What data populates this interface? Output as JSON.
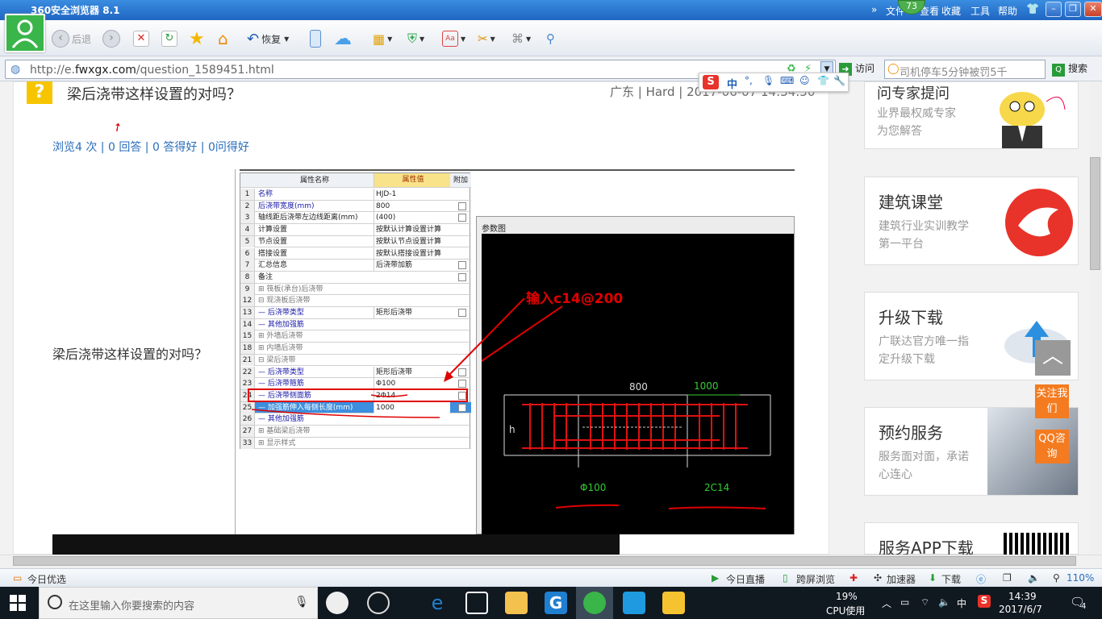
{
  "browser": {
    "title": "360安全浏览器 8.1",
    "menu": [
      "文件",
      "查看",
      "收藏",
      "工具",
      "帮助"
    ],
    "badge": "73",
    "toolbar": {
      "back": "后退",
      "restore": "恢复"
    },
    "address": {
      "prefix": "http://e.",
      "domain": "fwxgx.com",
      "path": "/question_1589451.html"
    },
    "visit_label": "访问",
    "search_value": "司机停车5分钟被罚5千",
    "search_button": "搜索"
  },
  "ime": {
    "lang": "中"
  },
  "question": {
    "title": "梁后浇带这样设置的对吗？",
    "meta": "广东 | Hard | 2017-06-07 14:34:50",
    "stats": {
      "views": "浏览4 次",
      "answers": "0 回答",
      "good": "0 答得好",
      "ask_good": "0问得好"
    },
    "body": "梁后浇带这样设置的对吗？"
  },
  "prop_grid": {
    "headers": [
      "属性名称",
      "属性值",
      "附加"
    ],
    "rows": [
      {
        "n": "1",
        "k": "名称",
        "v": "HJD-1",
        "check": false,
        "blue": true
      },
      {
        "n": "2",
        "k": "后浇带宽度(mm)",
        "v": "800",
        "check": true,
        "blue": true
      },
      {
        "n": "3",
        "k": "轴线距后浇带左边线距离(mm)",
        "v": "(400)",
        "check": true,
        "blue": false
      },
      {
        "n": "4",
        "k": "计算设置",
        "v": "按默认计算设置计算",
        "check": false,
        "blue": false
      },
      {
        "n": "5",
        "k": "节点设置",
        "v": "按默认节点设置计算",
        "check": false,
        "blue": false
      },
      {
        "n": "6",
        "k": "搭接设置",
        "v": "按默认搭接设置计算",
        "check": false,
        "blue": false
      },
      {
        "n": "7",
        "k": "汇总信息",
        "v": "后浇带加筋",
        "check": true,
        "blue": false
      },
      {
        "n": "8",
        "k": "备注",
        "v": "",
        "check": true,
        "blue": false
      },
      {
        "n": "9",
        "k": "⊞ 筏板(承台)后浇带",
        "v": "",
        "check": false,
        "blue": false,
        "grey": true
      },
      {
        "n": "12",
        "k": "⊟ 现浇板后浇带",
        "v": "",
        "check": false,
        "blue": false,
        "grey": true
      },
      {
        "n": "13",
        "k": "— 后浇带类型",
        "v": "矩形后浇带",
        "check": true,
        "blue": true
      },
      {
        "n": "14",
        "k": "— 其他加强筋",
        "v": "",
        "check": false,
        "blue": true
      },
      {
        "n": "15",
        "k": "⊞ 外墙后浇带",
        "v": "",
        "check": false,
        "blue": false,
        "grey": true
      },
      {
        "n": "18",
        "k": "⊞ 内墙后浇带",
        "v": "",
        "check": false,
        "blue": false,
        "grey": true
      },
      {
        "n": "21",
        "k": "⊟ 梁后浇带",
        "v": "",
        "check": false,
        "blue": false,
        "grey": true
      },
      {
        "n": "22",
        "k": "— 后浇带类型",
        "v": "矩形后浇带",
        "check": true,
        "blue": true
      },
      {
        "n": "23",
        "k": "— 后浇带箍筋",
        "v": "Φ100",
        "check": true,
        "blue": true
      },
      {
        "n": "24",
        "k": "— 后浇带侧面筋",
        "v": "2Φ14",
        "check": true,
        "blue": true
      },
      {
        "n": "25",
        "k": "— 加强筋伸入每侧长度(mm)",
        "v": "1000",
        "check": true,
        "blue": true,
        "sel": true
      },
      {
        "n": "26",
        "k": "— 其他加强筋",
        "v": "",
        "check": false,
        "blue": true
      },
      {
        "n": "27",
        "k": "⊞ 基础梁后浇带",
        "v": "",
        "check": false,
        "blue": false,
        "grey": true
      },
      {
        "n": "33",
        "k": "⊞ 显示样式",
        "v": "",
        "check": false,
        "blue": false,
        "grey": true
      }
    ]
  },
  "diagram": {
    "window_title": "参数图",
    "annotation": "输入c14@200",
    "dim_width": "800",
    "dim_anchor": "1000",
    "label_h": "h",
    "label_stirrup": "Φ100",
    "label_side": "2C14"
  },
  "sidebar": {
    "top": {
      "line1": "业界最权威专家",
      "line2": "为您解答",
      "heading": "问专家提问"
    },
    "cards": [
      {
        "h": "建筑课堂",
        "s": "建筑行业实训教学第一平台"
      },
      {
        "h": "升级下载",
        "s": "广联达官方唯一指定升级下载"
      },
      {
        "h": "预约服务",
        "s": "服务面对面，承诺心连心"
      },
      {
        "h": "服务APP下载",
        "s": ""
      }
    ],
    "follow": "关注我们",
    "qq": "QQ咨询"
  },
  "statusbar": {
    "left": "今日优选",
    "live": "今日直播",
    "cross": "跨屏浏览",
    "accel": "加速器",
    "download": "下载",
    "zoom": "110%"
  },
  "taskbar": {
    "search_placeholder": "在这里输入你要搜索的内容",
    "cpu_pct": "19%",
    "cpu_label": "CPU使用",
    "ime": "中",
    "time": "14:39",
    "date": "2017/6/7",
    "notif": "4"
  },
  "colors": {
    "titlebar": "#2b78d4",
    "accent": "#2a6ebb",
    "orange": "#f47b20",
    "red": "#e00000"
  }
}
